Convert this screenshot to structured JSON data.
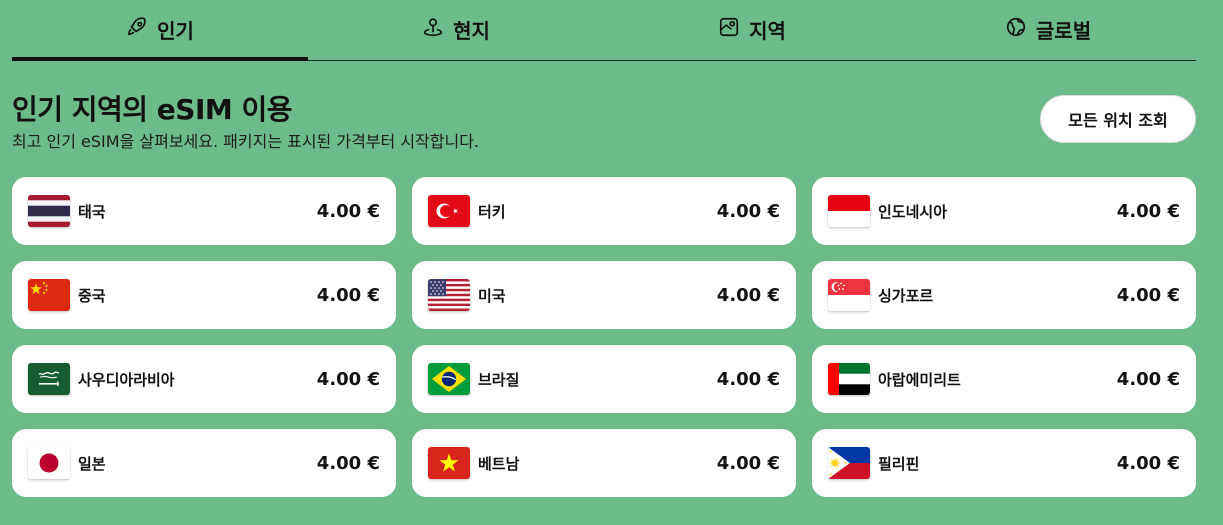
{
  "tabs": [
    {
      "label": "인기",
      "icon": "rocket-icon",
      "active": true
    },
    {
      "label": "현지",
      "icon": "location-pin-icon",
      "active": false
    },
    {
      "label": "지역",
      "icon": "map-icon",
      "active": false
    },
    {
      "label": "글로벌",
      "icon": "globe-icon",
      "active": false
    }
  ],
  "header": {
    "title": "인기 지역의 eSIM 이용",
    "subtitle": "최고 인기 eSIM을 살펴보세요. 패키지는 표시된 가격부터 시작합니다.",
    "view_all_label": "모든 위치 조회"
  },
  "countries": [
    {
      "name": "태국",
      "price": "4.00 €",
      "flag": "thailand-flag"
    },
    {
      "name": "터키",
      "price": "4.00 €",
      "flag": "turkey-flag"
    },
    {
      "name": "인도네시아",
      "price": "4.00 €",
      "flag": "indonesia-flag"
    },
    {
      "name": "중국",
      "price": "4.00 €",
      "flag": "china-flag"
    },
    {
      "name": "미국",
      "price": "4.00 €",
      "flag": "usa-flag"
    },
    {
      "name": "싱가포르",
      "price": "4.00 €",
      "flag": "singapore-flag"
    },
    {
      "name": "사우디아라비아",
      "price": "4.00 €",
      "flag": "saudi-arabia-flag"
    },
    {
      "name": "브라질",
      "price": "4.00 €",
      "flag": "brazil-flag"
    },
    {
      "name": "아랍에미리트",
      "price": "4.00 €",
      "flag": "uae-flag"
    },
    {
      "name": "일본",
      "price": "4.00 €",
      "flag": "japan-flag"
    },
    {
      "name": "베트남",
      "price": "4.00 €",
      "flag": "vietnam-flag"
    },
    {
      "name": "필리핀",
      "price": "4.00 €",
      "flag": "philippines-flag"
    }
  ]
}
